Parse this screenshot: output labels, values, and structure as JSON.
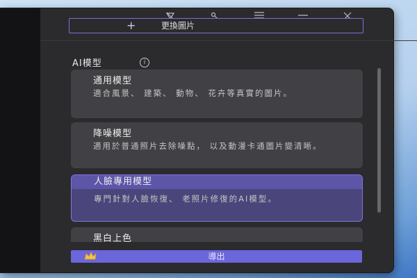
{
  "titlebar": {
    "icons": [
      "pin-icon",
      "key-icon",
      "menu-icon",
      "minimize-icon",
      "close-icon"
    ]
  },
  "toolbar": {
    "replace_label": "更換圖片",
    "replace_icon": "plus-icon"
  },
  "models": {
    "section_title": "AI模型",
    "info_icon": "info-icon",
    "items": [
      {
        "title": "通用模型",
        "desc": "適合風景、 建築、 動物、 花卉等真實的圖片。"
      },
      {
        "title": "降噪模型",
        "desc": "適用於普通照片去除噪點， 以及動漫卡通圖片變清晰。"
      },
      {
        "title": "人臉專用模型",
        "desc": "專門針對人臉恢復、 老照片修復的AI模型。"
      },
      {
        "title": "黑白上色",
        "desc": ""
      }
    ],
    "selected_index": 2
  },
  "export": {
    "label": "導出",
    "icon": "crown-icon"
  },
  "colors": {
    "accent": "#6c66db",
    "accent_border": "#7f76e0",
    "panel": "#2b2b2e",
    "card": "#414145",
    "card_selected": "#4a457a"
  }
}
